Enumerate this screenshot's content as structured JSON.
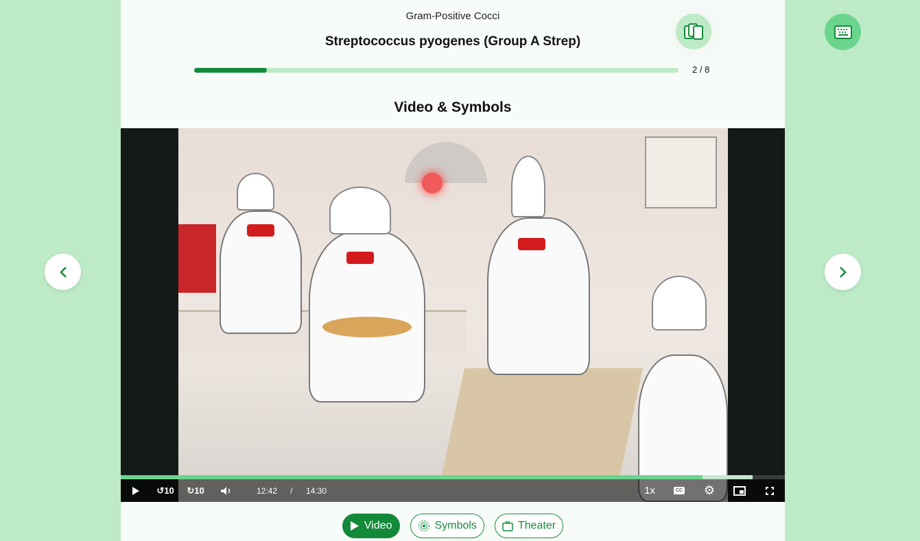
{
  "header": {
    "category": "Gram-Positive Cocci",
    "title": "Streptococcus pyogenes (Group A Strep)",
    "progress_fraction": 0.15,
    "counter": "2 / 8",
    "flashcards_icon": "cards-icon"
  },
  "section_title": "Video & Symbols",
  "player": {
    "current_time": "12:42",
    "separator": "/",
    "duration": "14:30",
    "played_fraction": 0.876,
    "buffered_fraction": 0.951,
    "speed": "1x"
  },
  "modes": [
    {
      "label": "Video",
      "icon": "play-icon",
      "active": true
    },
    {
      "label": "Symbols",
      "icon": "symbols-icon",
      "active": false
    },
    {
      "label": "Theater",
      "icon": "tv-icon",
      "active": false
    }
  ],
  "colors": {
    "accent": "#138a3a",
    "light": "#bdeac7",
    "mid": "#6bd58e"
  }
}
